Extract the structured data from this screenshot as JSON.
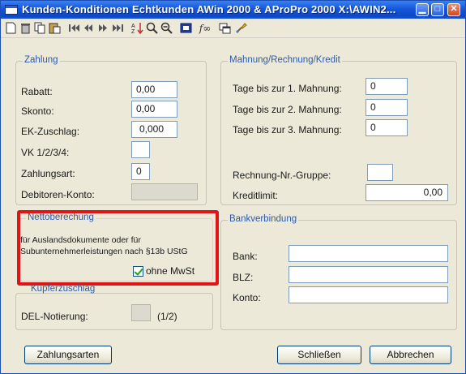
{
  "window": {
    "title": "Kunden-Konditionen   Echtkunden AWin 2000 & AProPro 2000   X:\\AWIN2...",
    "minimize": "▁",
    "maximize": "□",
    "close": "✕"
  },
  "toolbar": {
    "icons": [
      "new-doc-icon",
      "delete-icon",
      "copy-icon",
      "paste-icon",
      "first-record-icon",
      "prev-record-icon",
      "next-record-icon",
      "last-record-icon",
      "sort-icon",
      "search-icon",
      "zoom-out-icon",
      "form-icon",
      "formula-icon",
      "window-icon",
      "brush-icon"
    ],
    "formula_label": "f∞"
  },
  "zahlung": {
    "title": "Zahlung",
    "rabatt_label": "Rabatt:",
    "rabatt_value": "0,00",
    "skonto_label": "Skonto:",
    "skonto_value": "0,00",
    "ek_label": "EK-Zuschlag:",
    "ek_value": "0,000",
    "vk_label": "VK 1/2/3/4:",
    "vk_value": "",
    "zahlungsart_label": "Zahlungsart:",
    "zahlungsart_value": "0",
    "debitoren_label": "Debitoren-Konto:",
    "debitoren_value": ""
  },
  "mahnung": {
    "title": "Mahnung/Rechnung/Kredit",
    "tage1_label": "Tage bis zur 1. Mahnung:",
    "tage1_value": "0",
    "tage2_label": "Tage bis zur 2. Mahnung:",
    "tage2_value": "0",
    "tage3_label": "Tage bis zur 3. Mahnung:",
    "tage3_value": "0",
    "rechnung_label": "Rechnung-Nr.-Gruppe:",
    "rechnung_value": "",
    "kredit_label": "Kreditlimit:",
    "kredit_value": "0,00"
  },
  "netto": {
    "title": "Nettoberechung",
    "line1": "für Auslandsdokumente oder für",
    "line2": "Subunternehmerleistungen nach §13b UStG",
    "checkbox_label": "ohne MwSt",
    "checked": true
  },
  "kupfer": {
    "title": "Kupferzuschlag",
    "del_label": "DEL-Notierung:",
    "del_value": "",
    "del_hint": "(1/2)"
  },
  "bank": {
    "title": "Bankverbindung",
    "bank_label": "Bank:",
    "bank_value": "",
    "blz_label": "BLZ:",
    "blz_value": "",
    "konto_label": "Konto:",
    "konto_value": ""
  },
  "buttons": {
    "zahlungsarten": "Zahlungsarten",
    "schliessen": "Schließen",
    "abbrechen": "Abbrechen"
  },
  "colors": {
    "titlebar": "#1657d9",
    "group_title": "#2d5aa8",
    "highlight": "#e01515",
    "face": "#ece9d8"
  }
}
